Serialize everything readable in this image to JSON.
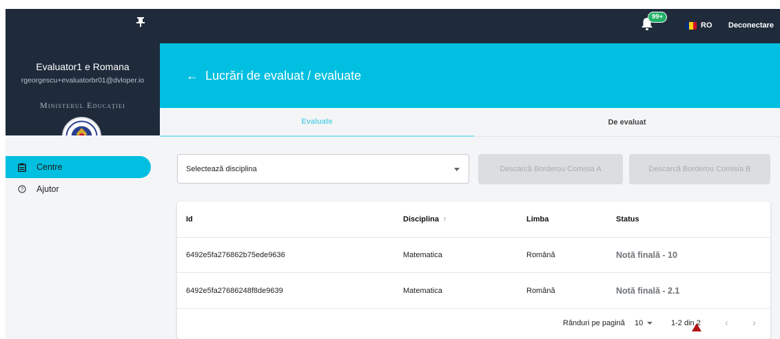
{
  "sidebar": {
    "user_name": "Evaluator1 e Romana",
    "user_email": "rgeorgescu+evaluatorbr01@dvloper.io",
    "ministry": "Ministerul Educației",
    "menu": [
      {
        "label": "Centre",
        "icon": "clipboard-icon",
        "active": true
      },
      {
        "label": "Ajutor",
        "icon": "help-icon",
        "active": false
      }
    ]
  },
  "header": {
    "notification_badge": "99+",
    "language": "RO",
    "logout": "Deconectare",
    "flag_colors": [
      "#002b7f",
      "#fcd116",
      "#ce1126"
    ]
  },
  "page": {
    "title": "Lucrări de evaluat / evaluate",
    "accent_color": "#00bfe0"
  },
  "tabs": [
    {
      "label": "Evaluate",
      "active": true
    },
    {
      "label": "De evaluat",
      "active": false
    }
  ],
  "filters": {
    "discipline_placeholder": "Selectează disciplina",
    "download_a": "Descarcă Borderou Comisia A",
    "download_b": "Descarcă Borderou Comisia B"
  },
  "table": {
    "columns": [
      "Id",
      "Disciplina",
      "Limba",
      "Status"
    ],
    "sort_indicator": "↑",
    "rows": [
      {
        "id": "6492e5fa276862b75ede9636",
        "discipline": "Matematica",
        "language": "Română",
        "status": "Notă finală - 10"
      },
      {
        "id": "6492e5fa27686248f8de9639",
        "discipline": "Matematica",
        "language": "Română",
        "status": "Notă finală - 2.1"
      }
    ]
  },
  "pagination": {
    "rows_per_page_label": "Rânduri pe pagină",
    "rows_per_page": "10",
    "range": "1-2 din 2"
  }
}
